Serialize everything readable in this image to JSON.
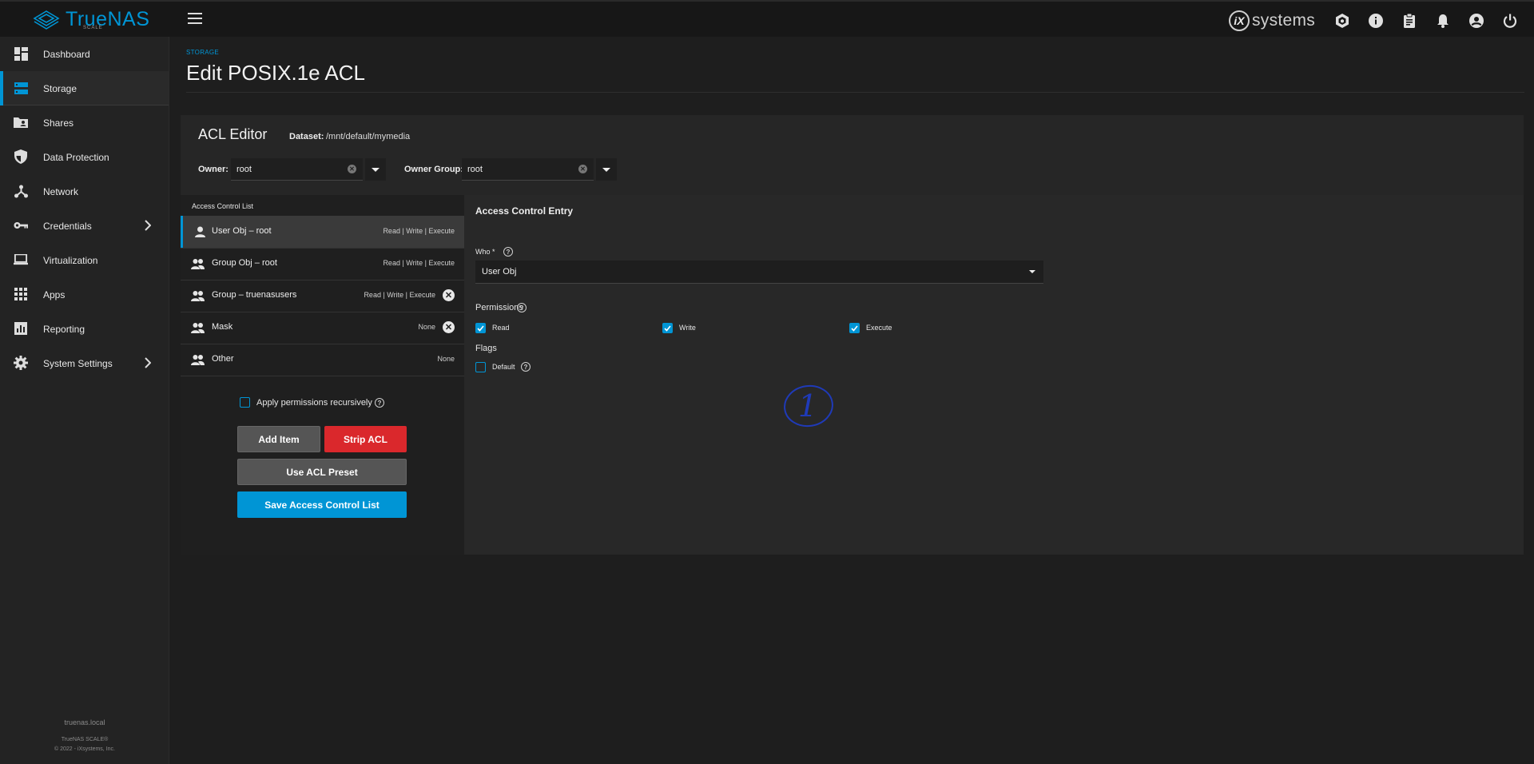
{
  "topbar": {
    "logo_text": "TrueNAS",
    "logo_sub": "SCALE",
    "vendor": "systems",
    "vendor_mark": "iX",
    "icons": [
      "truecommand-icon",
      "info-icon",
      "clipboard-icon",
      "bell-icon",
      "account-icon",
      "power-icon"
    ]
  },
  "sidebar": {
    "items": [
      {
        "label": "Dashboard",
        "icon": "dashboard-icon"
      },
      {
        "label": "Storage",
        "icon": "storage-icon",
        "active": true
      },
      {
        "label": "Shares",
        "icon": "folder-share-icon"
      },
      {
        "label": "Data Protection",
        "icon": "shield-icon"
      },
      {
        "label": "Network",
        "icon": "network-icon"
      },
      {
        "label": "Credentials",
        "icon": "key-icon",
        "chevron": true
      },
      {
        "label": "Virtualization",
        "icon": "laptop-icon"
      },
      {
        "label": "Apps",
        "icon": "apps-grid-icon"
      },
      {
        "label": "Reporting",
        "icon": "chart-icon"
      },
      {
        "label": "System Settings",
        "icon": "gear-icon",
        "chevron": true
      }
    ],
    "hostname": "truenas.local",
    "footer_product": "TrueNAS SCALE®",
    "footer_copy": "© 2022 - iXsystems, Inc."
  },
  "page": {
    "breadcrumb": "STORAGE",
    "title": "Edit POSIX.1e ACL"
  },
  "editor": {
    "title": "ACL Editor",
    "dataset_label": "Dataset:",
    "dataset_value": "/mnt/default/mymedia",
    "owner_label": "Owner:",
    "owner_value": "root",
    "owner_group_label": "Owner Group:",
    "owner_group_value": "root"
  },
  "acl_list": {
    "heading": "Access Control List",
    "rows": [
      {
        "label": "User Obj – root",
        "perms": "Read | Write | Execute",
        "icon": "person-icon",
        "removable": false,
        "selected": true
      },
      {
        "label": "Group Obj – root",
        "perms": "Read | Write | Execute",
        "icon": "group-icon",
        "removable": false
      },
      {
        "label": "Group – truenasusers",
        "perms": "Read | Write | Execute",
        "icon": "group-icon",
        "removable": true
      },
      {
        "label": "Mask",
        "perms": "None",
        "icon": "group-icon",
        "removable": true
      },
      {
        "label": "Other",
        "perms": "None",
        "icon": "group-icon",
        "removable": false
      }
    ],
    "recursive_label": "Apply permissions recursively",
    "recursive_checked": false,
    "add_item": "Add Item",
    "strip_acl": "Strip ACL",
    "use_preset": "Use ACL Preset",
    "save": "Save Access Control List"
  },
  "entry": {
    "title": "Access Control Entry",
    "who_label": "Who *",
    "who_value": "User Obj",
    "permissions_label": "Permissions",
    "perms": [
      {
        "label": "Read",
        "checked": true
      },
      {
        "label": "Write",
        "checked": true
      },
      {
        "label": "Execute",
        "checked": true
      }
    ],
    "flags_label": "Flags",
    "default_label": "Default",
    "default_checked": false,
    "annotation": "1"
  }
}
